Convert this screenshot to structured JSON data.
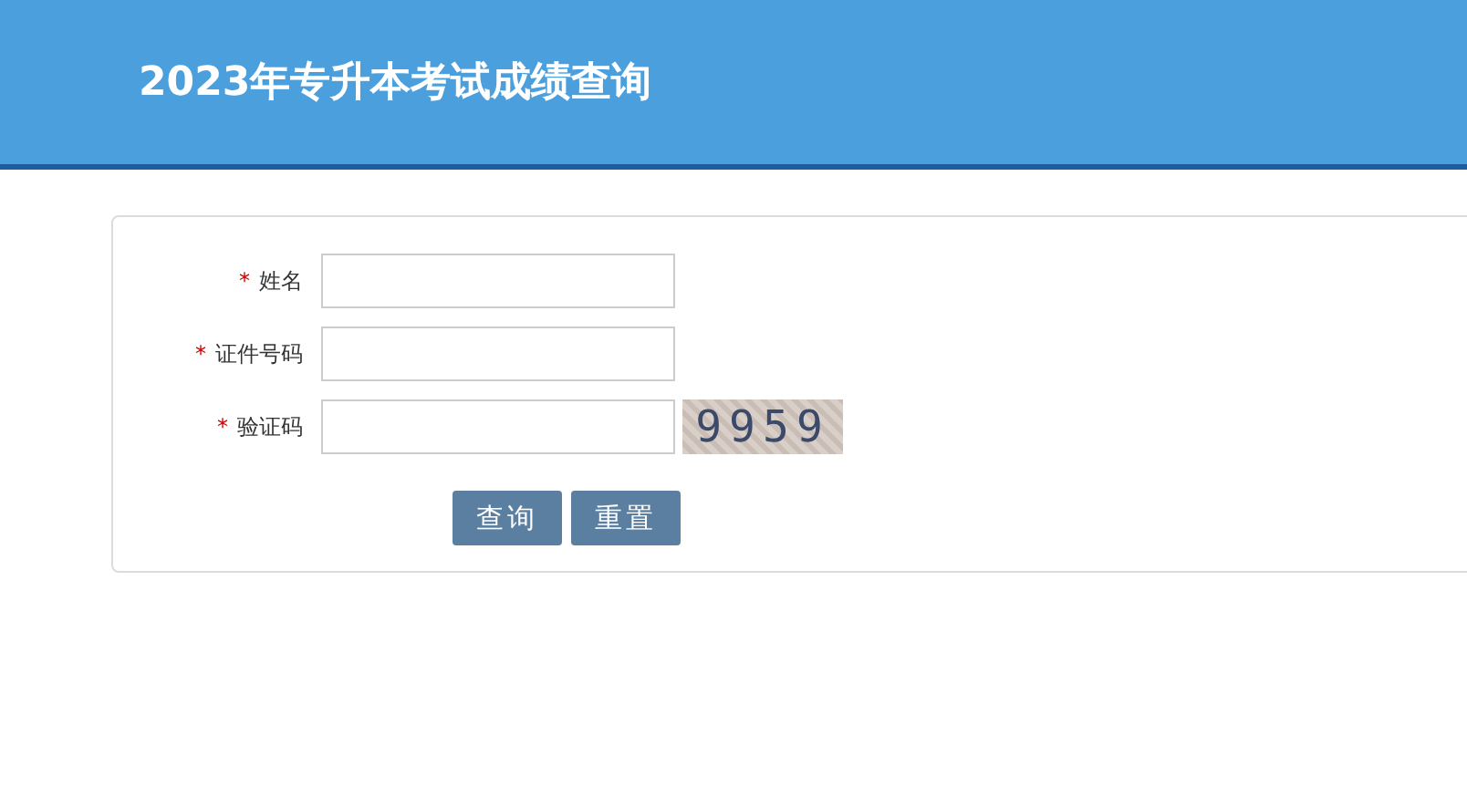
{
  "header": {
    "title": "2023年专升本考试成绩查询"
  },
  "form": {
    "fields": [
      {
        "label": "姓名",
        "required": true
      },
      {
        "label": "证件号码",
        "required": true
      },
      {
        "label": "验证码",
        "required": true,
        "captcha": "9959"
      }
    ],
    "required_mark": "*",
    "buttons": [
      "查询",
      "重置"
    ]
  }
}
